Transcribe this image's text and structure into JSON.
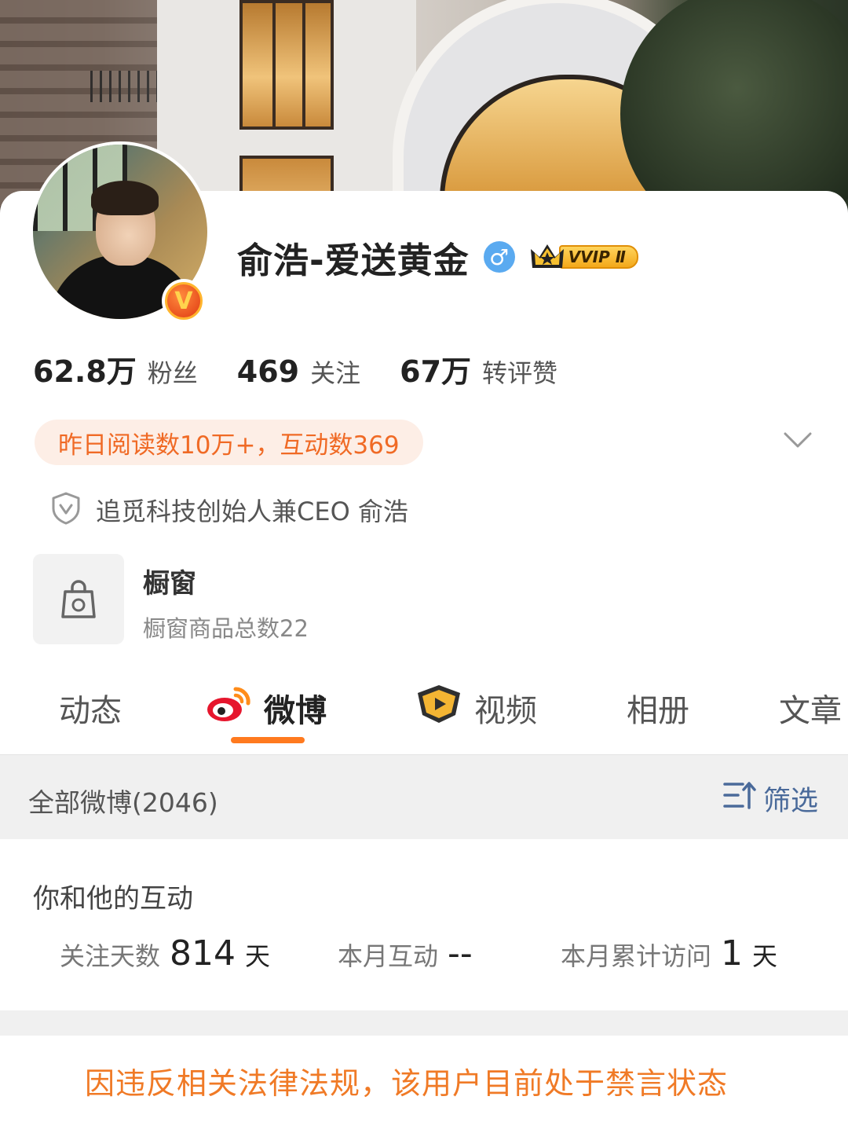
{
  "profile": {
    "name": "俞浩-爱送黄金",
    "gender_symbol": "♂",
    "vvip_label": "VVIP Ⅱ",
    "verified_badge": "V"
  },
  "stats": [
    {
      "num": "62.8万",
      "label": "粉丝"
    },
    {
      "num": "469",
      "label": "关注"
    },
    {
      "num": "67万",
      "label": "转评赞"
    }
  ],
  "reads_pill": "昨日阅读数10万+，互动数369",
  "certification": "追觅科技创始人兼CEO 俞浩",
  "shop": {
    "title": "橱窗",
    "subtitle": "橱窗商品总数22"
  },
  "tabs": [
    {
      "label": "动态",
      "icon": null
    },
    {
      "label": "微博",
      "icon": "weibo-logo-icon"
    },
    {
      "label": "视频",
      "icon": "video-play-icon"
    },
    {
      "label": "相册",
      "icon": null
    },
    {
      "label": "文章",
      "icon": null
    }
  ],
  "filter_bar": {
    "all_posts": "全部微博(2046)",
    "filter_label": "筛选"
  },
  "interaction": {
    "title": "你和他的互动",
    "follow_days_label": "关注天数",
    "follow_days_value": "814",
    "follow_days_unit": "天",
    "monthly_label": "本月互动",
    "monthly_value": "--",
    "visits_label": "本月累计访问",
    "visits_value": "1",
    "visits_unit": "天"
  },
  "ban_notice": "因违反相关法律法规，该用户目前处于禁言状态",
  "colors": {
    "accent_orange": "#ff7a1f",
    "pill_bg": "#fdeee6",
    "filter_blue": "#4a6a9a",
    "gender_blue": "#5aaaf0"
  }
}
